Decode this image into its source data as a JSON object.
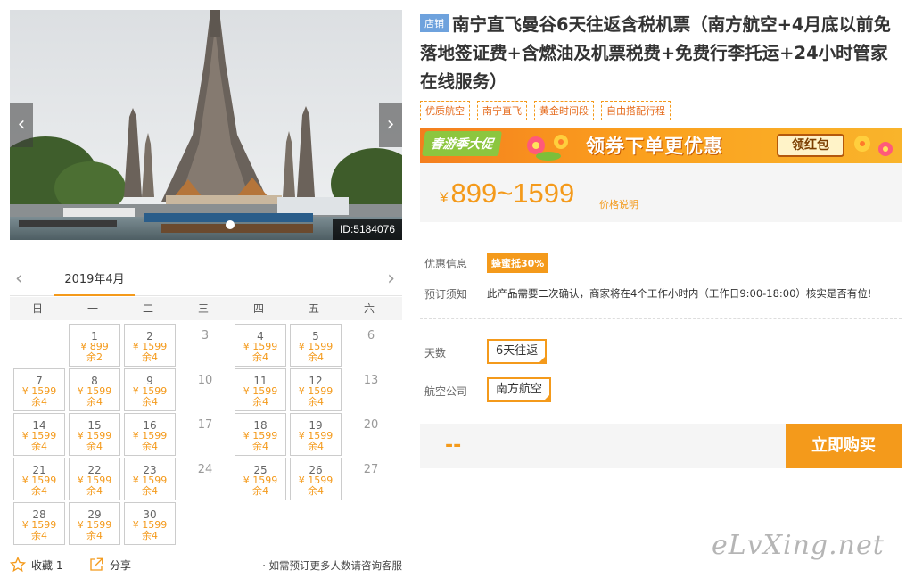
{
  "gallery": {
    "id_label": "ID:5184076",
    "prev": "‹",
    "next": "›"
  },
  "calendar": {
    "month": "2019年4月",
    "prev": "‹",
    "next": "›",
    "weekdays": [
      "日",
      "一",
      "二",
      "三",
      "四",
      "五",
      "六"
    ],
    "days": [
      {
        "day": "1",
        "col": 1,
        "row": 0,
        "price": "¥ 899",
        "remain": "余2"
      },
      {
        "day": "2",
        "col": 2,
        "row": 0,
        "price": "¥ 1599",
        "remain": "余4"
      },
      {
        "day": "3",
        "col": 3,
        "row": 0
      },
      {
        "day": "4",
        "col": 4,
        "row": 0,
        "price": "¥ 1599",
        "remain": "余4"
      },
      {
        "day": "5",
        "col": 5,
        "row": 0,
        "price": "¥ 1599",
        "remain": "余4"
      },
      {
        "day": "6",
        "col": 6,
        "row": 0
      },
      {
        "day": "7",
        "col": 0,
        "row": 1,
        "price": "¥ 1599",
        "remain": "余4"
      },
      {
        "day": "8",
        "col": 1,
        "row": 1,
        "price": "¥ 1599",
        "remain": "余4"
      },
      {
        "day": "9",
        "col": 2,
        "row": 1,
        "price": "¥ 1599",
        "remain": "余4"
      },
      {
        "day": "10",
        "col": 3,
        "row": 1
      },
      {
        "day": "11",
        "col": 4,
        "row": 1,
        "price": "¥ 1599",
        "remain": "余4"
      },
      {
        "day": "12",
        "col": 5,
        "row": 1,
        "price": "¥ 1599",
        "remain": "余4"
      },
      {
        "day": "13",
        "col": 6,
        "row": 1
      },
      {
        "day": "14",
        "col": 0,
        "row": 2,
        "price": "¥ 1599",
        "remain": "余4"
      },
      {
        "day": "15",
        "col": 1,
        "row": 2,
        "price": "¥ 1599",
        "remain": "余4"
      },
      {
        "day": "16",
        "col": 2,
        "row": 2,
        "price": "¥ 1599",
        "remain": "余4"
      },
      {
        "day": "17",
        "col": 3,
        "row": 2
      },
      {
        "day": "18",
        "col": 4,
        "row": 2,
        "price": "¥ 1599",
        "remain": "余4"
      },
      {
        "day": "19",
        "col": 5,
        "row": 2,
        "price": "¥ 1599",
        "remain": "余4"
      },
      {
        "day": "20",
        "col": 6,
        "row": 2
      },
      {
        "day": "21",
        "col": 0,
        "row": 3,
        "price": "¥ 1599",
        "remain": "余4"
      },
      {
        "day": "22",
        "col": 1,
        "row": 3,
        "price": "¥ 1599",
        "remain": "余4"
      },
      {
        "day": "23",
        "col": 2,
        "row": 3,
        "price": "¥ 1599",
        "remain": "余4"
      },
      {
        "day": "24",
        "col": 3,
        "row": 3
      },
      {
        "day": "25",
        "col": 4,
        "row": 3,
        "price": "¥ 1599",
        "remain": "余4"
      },
      {
        "day": "26",
        "col": 5,
        "row": 3,
        "price": "¥ 1599",
        "remain": "余4"
      },
      {
        "day": "27",
        "col": 6,
        "row": 3
      },
      {
        "day": "28",
        "col": 0,
        "row": 4,
        "price": "¥ 1599",
        "remain": "余4"
      },
      {
        "day": "29",
        "col": 1,
        "row": 4,
        "price": "¥ 1599",
        "remain": "余4"
      },
      {
        "day": "30",
        "col": 2,
        "row": 4,
        "price": "¥ 1599",
        "remain": "余4"
      }
    ]
  },
  "bottom": {
    "favorite": "收藏 1",
    "share": "分享",
    "consult": "· 如需预订更多人数请咨询客服"
  },
  "product": {
    "shop_badge": "店铺",
    "title": "南宁直飞曼谷6天往返含税机票（南方航空+4月底以前免落地签证费+含燃油及机票税费+免费行李托运+24小时管家在线服务）",
    "tags": [
      "优质航空",
      "南宁直飞",
      "黄金时间段",
      "自由搭配行程"
    ],
    "banner": {
      "left": "春游季大促",
      "middle": "领券下单更优惠",
      "button": "领红包"
    },
    "price": {
      "currency": "¥",
      "range": "899~1599",
      "note": "价格说明"
    },
    "promo_label": "优惠信息",
    "promo_badge": "蜂蜜抵30%",
    "notice_label": "预订须知",
    "notice_text": "此产品需要二次确认，商家将在4个工作小时内（工作日9:00-18:00）核实是否有位!",
    "days_label": "天数",
    "days_option": "6天往返",
    "airline_label": "航空公司",
    "airline_option": "南方航空",
    "total": "--",
    "buy_button": "立即购买"
  },
  "watermark": "eLvXing.net",
  "colors": {
    "accent": "#f49a1b",
    "shop_badge": "#6ea2dd"
  }
}
